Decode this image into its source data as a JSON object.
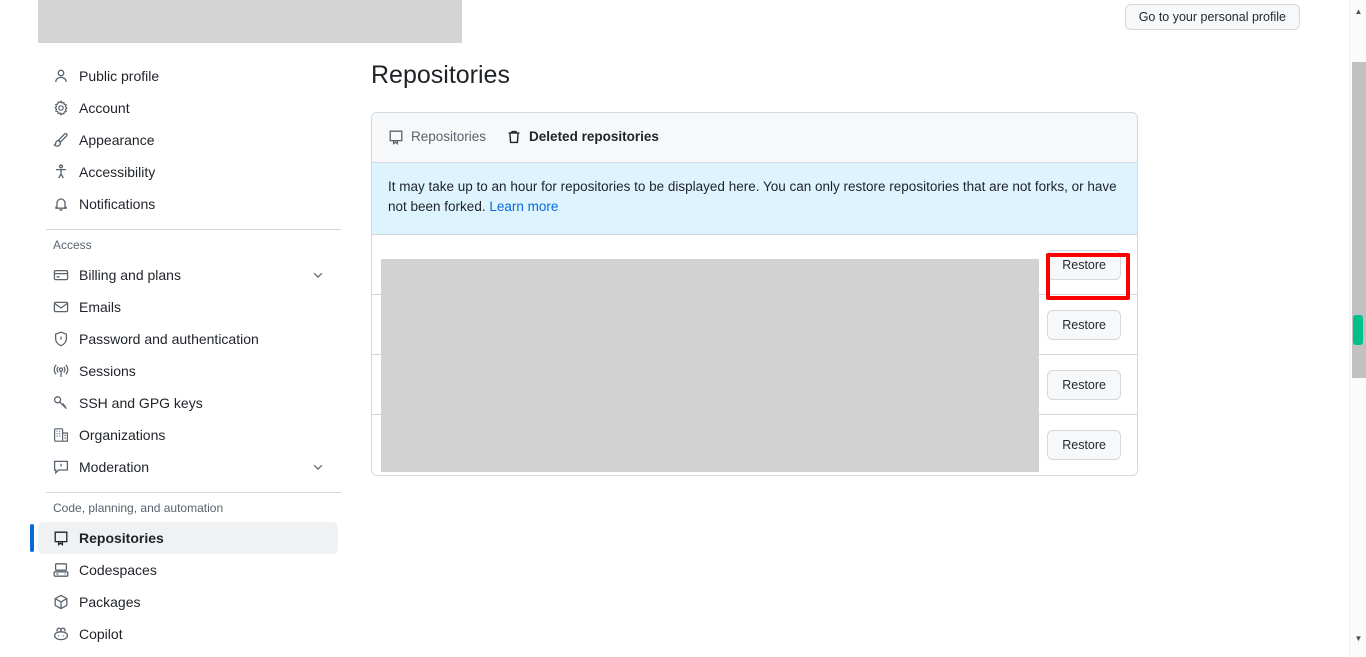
{
  "header": {
    "personal_profile_button": "Go to your personal profile"
  },
  "sidebar": {
    "groups": [
      {
        "title": null,
        "items": [
          {
            "label": "Public profile",
            "icon": "person-icon",
            "active": false,
            "chevron": false
          },
          {
            "label": "Account",
            "icon": "gear-icon",
            "active": false,
            "chevron": false
          },
          {
            "label": "Appearance",
            "icon": "paintbrush-icon",
            "active": false,
            "chevron": false
          },
          {
            "label": "Accessibility",
            "icon": "accessibility-icon",
            "active": false,
            "chevron": false
          },
          {
            "label": "Notifications",
            "icon": "bell-icon",
            "active": false,
            "chevron": false
          }
        ]
      },
      {
        "title": "Access",
        "items": [
          {
            "label": "Billing and plans",
            "icon": "credit-card-icon",
            "active": false,
            "chevron": true
          },
          {
            "label": "Emails",
            "icon": "mail-icon",
            "active": false,
            "chevron": false
          },
          {
            "label": "Password and authentication",
            "icon": "shield-lock-icon",
            "active": false,
            "chevron": false
          },
          {
            "label": "Sessions",
            "icon": "broadcast-icon",
            "active": false,
            "chevron": false
          },
          {
            "label": "SSH and GPG keys",
            "icon": "key-icon",
            "active": false,
            "chevron": false
          },
          {
            "label": "Organizations",
            "icon": "organization-icon",
            "active": false,
            "chevron": false
          },
          {
            "label": "Moderation",
            "icon": "report-icon",
            "active": false,
            "chevron": true
          }
        ]
      },
      {
        "title": "Code, planning, and automation",
        "items": [
          {
            "label": "Repositories",
            "icon": "repo-icon",
            "active": true,
            "chevron": false
          },
          {
            "label": "Codespaces",
            "icon": "codespaces-icon",
            "active": false,
            "chevron": false
          },
          {
            "label": "Packages",
            "icon": "package-icon",
            "active": false,
            "chevron": false
          },
          {
            "label": "Copilot",
            "icon": "copilot-icon",
            "active": false,
            "chevron": false
          }
        ]
      }
    ]
  },
  "main": {
    "page_title": "Repositories",
    "tabs": [
      {
        "label": "Repositories",
        "icon": "repo-icon",
        "active": false
      },
      {
        "label": "Deleted repositories",
        "icon": "trash-icon",
        "active": true
      }
    ],
    "info_banner": {
      "text": "It may take up to an hour for repositories to be displayed here. You can only restore repositories that are not forks, or have not been forked.",
      "link_text": "Learn more"
    },
    "rows": [
      {
        "restore_label": "Restore",
        "highlighted": true
      },
      {
        "restore_label": "Restore",
        "highlighted": false
      },
      {
        "restore_label": "Restore",
        "highlighted": false
      },
      {
        "restore_label": "Restore",
        "highlighted": false
      }
    ]
  },
  "scrollbar": {
    "up_arrow": "▲",
    "down_arrow": "▼"
  },
  "colors": {
    "accent": "#0969da",
    "highlight_box": "#ff0000",
    "info_banner_bg": "#ddf4ff",
    "scroll_marker": "#00c08b",
    "redaction": "#d2d2d2"
  }
}
